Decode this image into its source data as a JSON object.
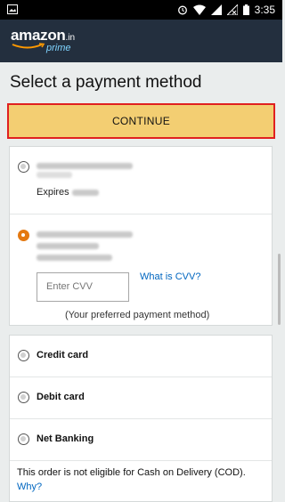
{
  "status_bar": {
    "time": "3:35",
    "icons": [
      "image-icon",
      "alarm-icon",
      "wifi-icon",
      "signal-icon",
      "no-signal-icon",
      "battery-icon"
    ]
  },
  "header": {
    "logo_word": "amazon",
    "logo_tld": ".in",
    "logo_sub": "prime",
    "bg_color": "#232f3e"
  },
  "page": {
    "title": "Select a payment method"
  },
  "continue_button": {
    "label": "CONTINUE",
    "color": "#f3ce72",
    "highlight_color": "#e02020"
  },
  "saved_cards": [
    {
      "expires_label": "Expires",
      "selected": false
    },
    {
      "selected": true,
      "cvv_placeholder": "Enter CVV",
      "cvv_link": "What is CVV?",
      "preferred_note": "(Your preferred payment method)"
    }
  ],
  "methods": [
    {
      "label": "Credit card"
    },
    {
      "label": "Debit card"
    },
    {
      "label": "Net Banking"
    }
  ],
  "cod": {
    "note": "This order is not eligible for Cash on Delivery (COD).",
    "link": "Why?"
  },
  "colors": {
    "link": "#0066c0",
    "radio_selected": "#e47911"
  }
}
